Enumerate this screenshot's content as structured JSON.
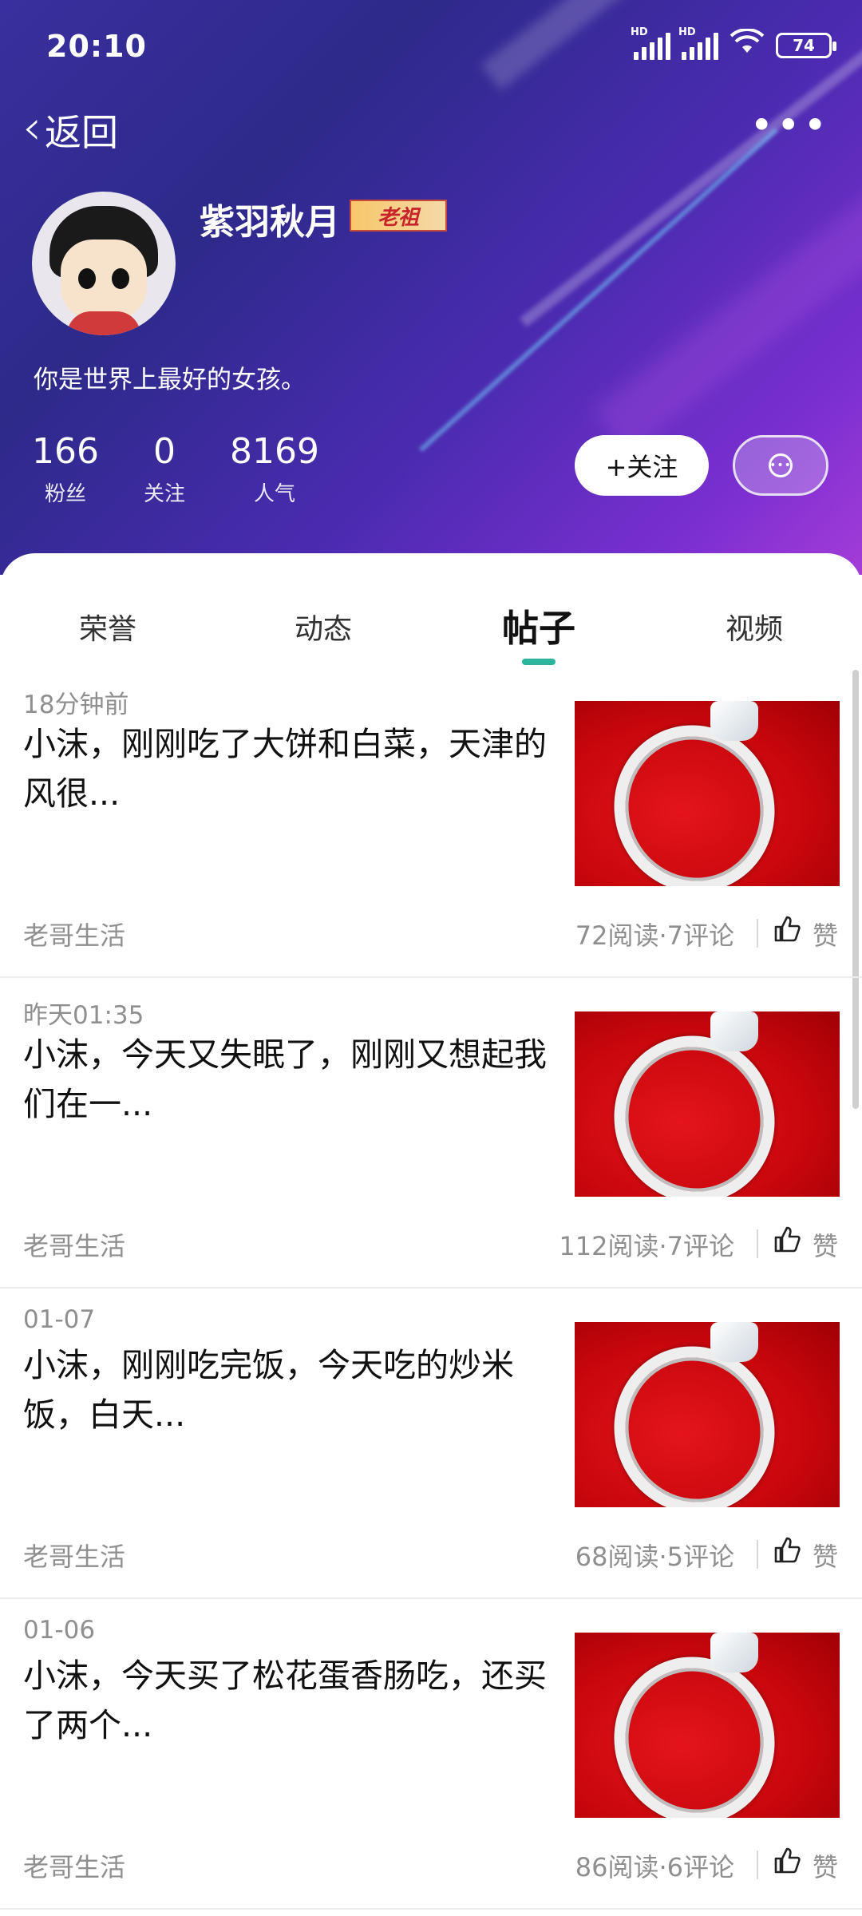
{
  "status_bar": {
    "time": "20:10",
    "hd_label": "HD",
    "wifi_extra": "6",
    "battery": "74"
  },
  "header": {
    "back_label": "返回",
    "more_label": "•••",
    "nickname": "紫羽秋月",
    "badge_label": "老祖",
    "signature": "你是世界上最好的女孩。",
    "stats": [
      {
        "num": "166",
        "label": "粉丝"
      },
      {
        "num": "0",
        "label": "关注"
      },
      {
        "num": "8169",
        "label": "人气"
      }
    ],
    "follow_label": "+关注",
    "chat_icon_dots": "•••"
  },
  "tabs": [
    {
      "label": "荣誉"
    },
    {
      "label": "动态"
    },
    {
      "label": "帖子"
    },
    {
      "label": "视频"
    }
  ],
  "active_tab": "帖子",
  "posts": [
    {
      "time": "18分钟前",
      "title": "小沫，刚刚吃了大饼和白菜，天津的风很...",
      "author": "老哥生活",
      "stats": "72阅读·7评论",
      "like_label": "赞"
    },
    {
      "time": "昨天01:35",
      "title": "小沫，今天又失眠了，刚刚又想起我们在一...",
      "author": "老哥生活",
      "stats": "112阅读·7评论",
      "like_label": "赞"
    },
    {
      "time": "01-07",
      "title": "小沫，刚刚吃完饭，今天吃的炒米饭，白天...",
      "author": "老哥生活",
      "stats": "68阅读·5评论",
      "like_label": "赞"
    },
    {
      "time": "01-06",
      "title": "小沫，今天买了松花蛋香肠吃，还买了两个...",
      "author": "老哥生活",
      "stats": "86阅读·6评论",
      "like_label": "赞"
    }
  ],
  "colors": {
    "accent": "#2cb59d",
    "header_start": "#3a2f9e",
    "header_end": "#a43cd8"
  }
}
